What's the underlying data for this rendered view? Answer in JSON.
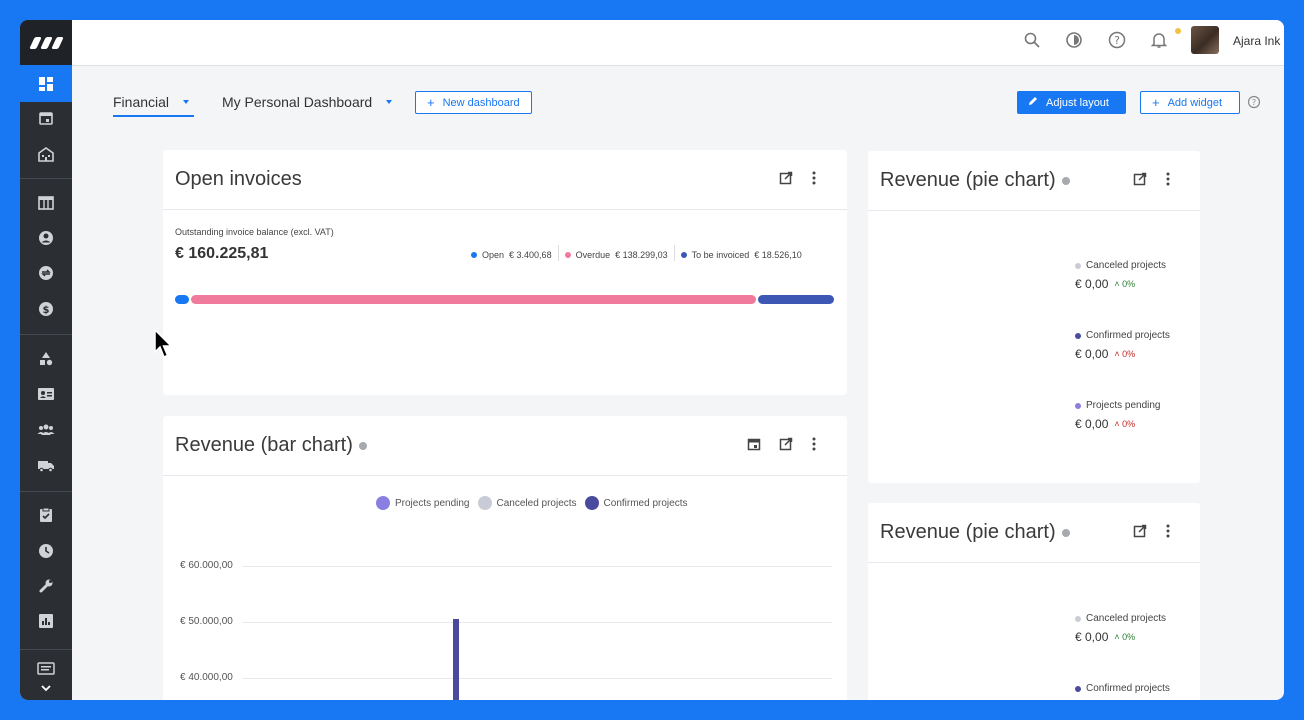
{
  "topbar": {
    "user_name": "Ajara Ink"
  },
  "dashboard_tabs": [
    {
      "label": "Financial"
    },
    {
      "label": "My Personal Dashboard"
    }
  ],
  "actions": {
    "new_dashboard": "New dashboard",
    "adjust_layout": "Adjust layout",
    "add_widget": "Add widget"
  },
  "open_invoices": {
    "title": "Open invoices",
    "subtitle": "Outstanding invoice balance (excl. VAT)",
    "total": "€ 160.225,81",
    "legend": [
      {
        "label": "Open",
        "amount": "€ 3.400,68",
        "color": "#1877f2",
        "share": 0.021
      },
      {
        "label": "Overdue",
        "amount": "€ 138.299,03",
        "color": "#f07a9c",
        "share": 0.863
      },
      {
        "label": "To be invoiced",
        "amount": "€ 18.526,10",
        "color": "#3d58b4",
        "share": 0.116
      }
    ]
  },
  "bar_chart_card": {
    "title": "Revenue (bar chart)"
  },
  "pie_card_1": {
    "title": "Revenue (pie chart)",
    "items": [
      {
        "label": "Canceled projects",
        "value": "€ 0,00",
        "pct": "0%",
        "color": "#c9cbd6",
        "pct_color": "#2e7d32"
      },
      {
        "label": "Confirmed projects",
        "value": "€ 0,00",
        "pct": "0%",
        "color": "#4b4b9e",
        "pct_color": "#c62828"
      },
      {
        "label": "Projects pending",
        "value": "€ 0,00",
        "pct": "0%",
        "color": "#8a7fe0",
        "pct_color": "#c62828"
      }
    ]
  },
  "pie_card_2": {
    "title": "Revenue (pie chart)",
    "items": [
      {
        "label": "Canceled projects",
        "value": "€ 0,00",
        "pct": "0%",
        "color": "#c9cbd6",
        "pct_color": "#2e7d32"
      },
      {
        "label": "Confirmed projects",
        "color": "#4b4b9e"
      }
    ]
  },
  "chart_data": {
    "type": "bar",
    "title": "Revenue (bar chart)",
    "series": [
      {
        "name": "Projects pending",
        "color": "#8a7fe0"
      },
      {
        "name": "Canceled projects",
        "color": "#c9cbd6"
      },
      {
        "name": "Confirmed projects",
        "color": "#4b4b9e"
      }
    ],
    "ytick_labels": [
      "€ 60.000,00",
      "€ 50.000,00",
      "€ 40.000,00"
    ],
    "yticks": [
      60000,
      50000,
      40000
    ],
    "visible_ylim": [
      35000,
      61000
    ],
    "bars": [
      {
        "series": "Confirmed projects",
        "value": 50500
      }
    ]
  }
}
